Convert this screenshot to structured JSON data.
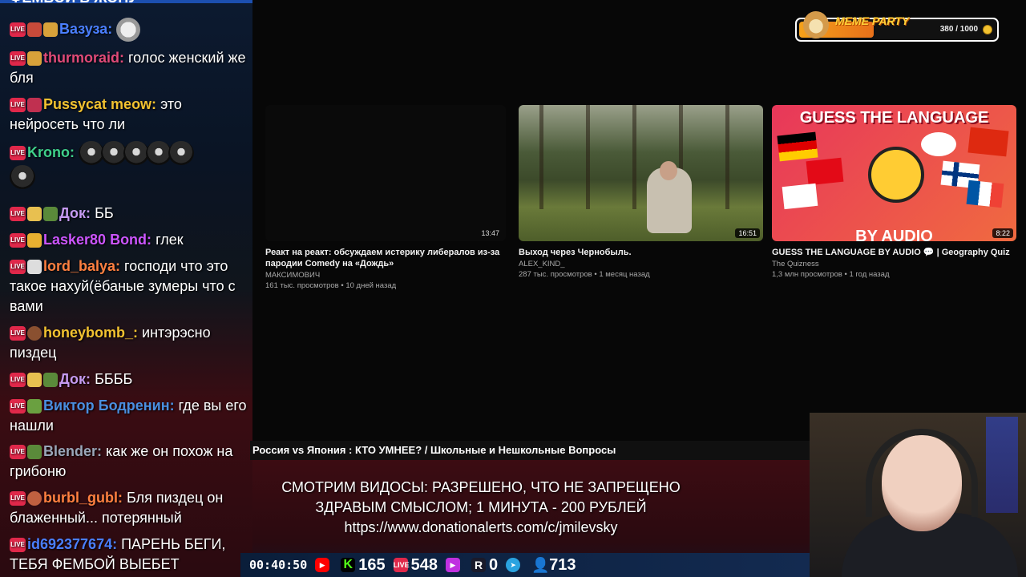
{
  "chat": {
    "cut_text": "ФЕМБОЙ В ЖОПУ",
    "messages": [
      {
        "nick": "Вазуза:",
        "text": "",
        "color": "#4a7fff"
      },
      {
        "nick": "thurmoraid:",
        "text": "голос женский же бля",
        "color": "#e04a78"
      },
      {
        "nick": "Pussycat meow:",
        "text": "это нейросеть что ли",
        "color": "#f2c230"
      },
      {
        "nick": "Krono:",
        "text": "",
        "color": "#3fd08a"
      },
      {
        "nick": "Док:",
        "text": "ББ",
        "color": "#c59af0"
      },
      {
        "nick": "Lasker80 Bond:",
        "text": "глек",
        "color": "#cc55ff"
      },
      {
        "nick": "lord_balya:",
        "text": "господи что это такое нахуй(ёбаные зумеры что с вами",
        "color": "#ff8040"
      },
      {
        "nick": "honeybomb_:",
        "text": "интэрэсно пиздец",
        "color": "#f2c230"
      },
      {
        "nick": "Док:",
        "text": "ББББ",
        "color": "#c59af0"
      },
      {
        "nick": "Виктор Бодренин:",
        "text": "где вы его нашли",
        "color": "#4a8fe0"
      },
      {
        "nick": "Blender:",
        "text": "как же он похож на грибоню",
        "color": "#9aa6b8"
      },
      {
        "nick": "burbl_gubl:",
        "text": "Бля пиздец он блаженный... потерянный",
        "color": "#ff8040"
      },
      {
        "nick": "id692377674:",
        "text": "ПАРЕНЬ БЕГИ, ТЕБЯ ФЕМБОЙ ВЫЕБЕТ",
        "color": "#4a7fff"
      }
    ]
  },
  "meme_party": {
    "title": "MEME PARTY",
    "progress": "380 / 1000",
    "progress_fraction": 0.38
  },
  "videos": [
    {
      "title": "Реакт на реакт: обсуждаем истерику либералов из-за пародии Comedy на «Дождь»",
      "channel": "МАКСИМОВИЧ",
      "meta": "161 тыс. просмотров • 10 дней назад",
      "duration": "13:47"
    },
    {
      "title": "Выход через Чернобыль.",
      "channel": "ALEX_KIND_",
      "meta": "287 тыс. просмотров • 1 месяц назад",
      "duration": "16:51"
    },
    {
      "title": "GUESS THE LANGUAGE BY AUDIO 💬 | Geography Quiz",
      "channel": "The Quizness",
      "meta": "1,3 млн просмотров • 1 год назад",
      "duration": "8:22",
      "thumb_text": "GUESS THE LANGUAGE",
      "thumb_text2": "BY AUDIO"
    }
  ],
  "banner": {
    "topic": "Россия vs Япония : КТО УМНЕЕ? / Школьные и Нешкольные Вопросы",
    "rules_line1": "СМОТРИМ ВИДОСЫ: РАЗРЕШЕНО, ЧТО НЕ ЗАПРЕЩЕНО",
    "rules_line2": "ЗДРАВЫМ СМЫСЛОМ; 1 МИНУТА - 200 РУБЛЕЙ",
    "rules_line3": "https://www.donationalerts.com/c/jmilevsky"
  },
  "stats": {
    "uptime": "00:40:50",
    "kick": "165",
    "vk": "548",
    "rutube": "0",
    "viewers": "713"
  },
  "colors": {
    "live": "#e0284a",
    "meme_fill": "#f4a11a",
    "kick": "#53fc18"
  }
}
